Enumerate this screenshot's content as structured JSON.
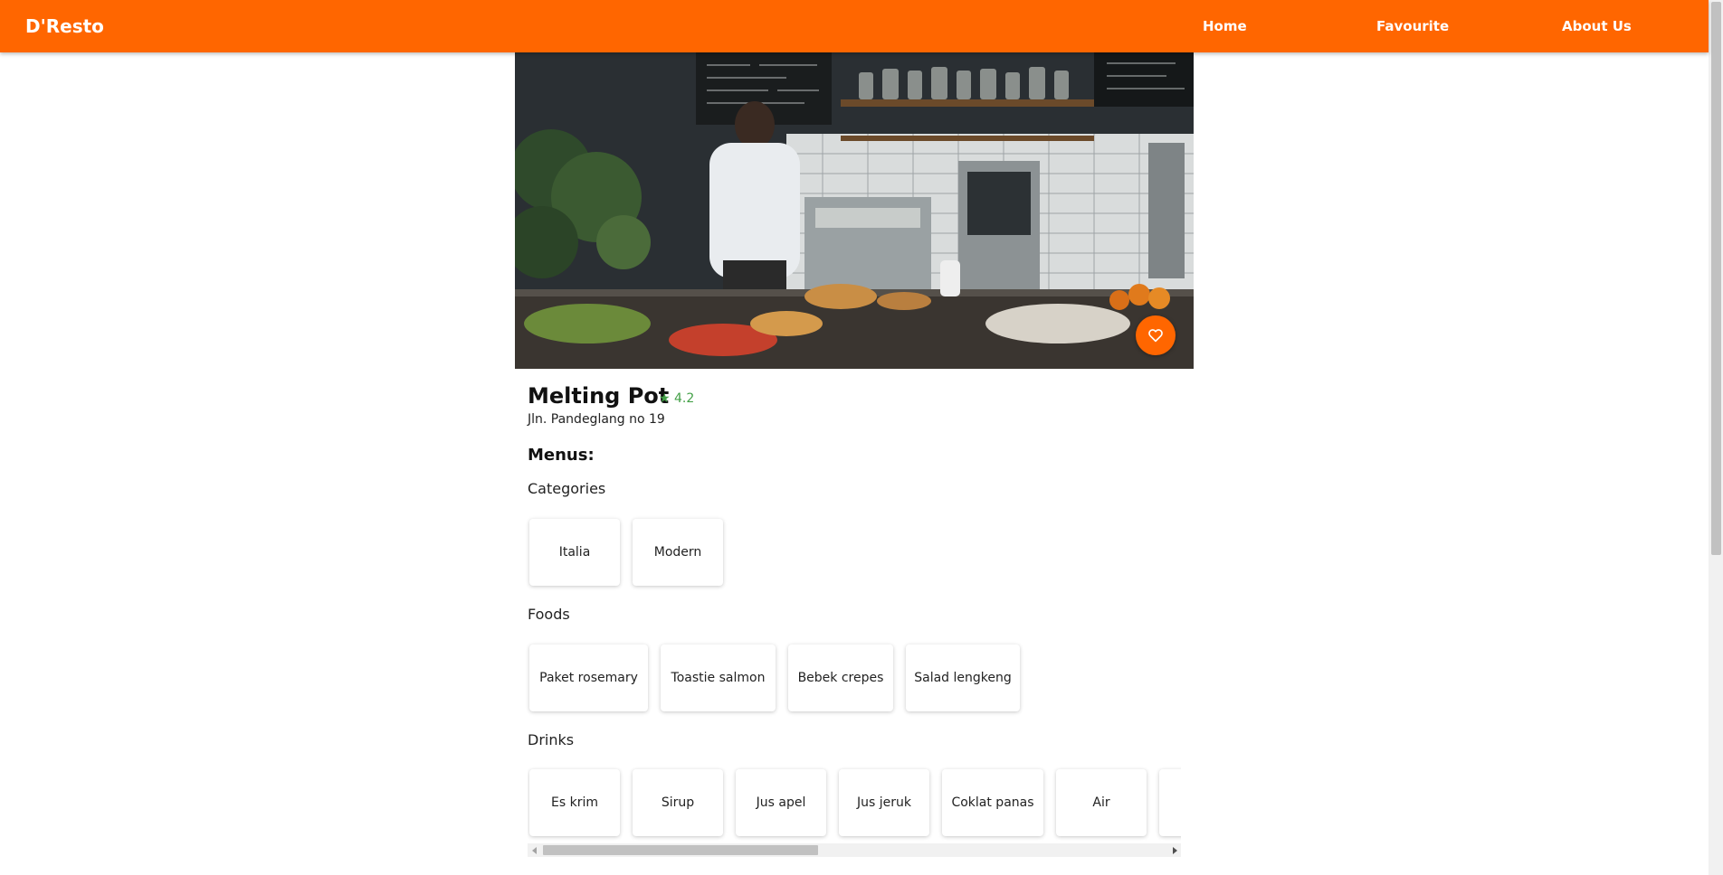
{
  "header": {
    "brand": "D'Resto",
    "nav": [
      "Home",
      "Favourite",
      "About Us"
    ],
    "color": "#ff6600"
  },
  "restaurant": {
    "name": "Melting Pot",
    "rating": "★ 4.2",
    "address": "Jln. Pandeglang no 19",
    "image_alt": "Melting Pot",
    "favourite_icon": "heart-outline-icon"
  },
  "menus": {
    "heading": "Menus:",
    "categories_label": "Categories",
    "categories": [
      "Italia",
      "Modern"
    ],
    "foods_label": "Foods",
    "foods": [
      "Paket rosemary",
      "Toastie salmon",
      "Bebek crepes",
      "Salad lengkeng"
    ],
    "drinks_label": "Drinks",
    "drinks": [
      "Es krim",
      "Sirup",
      "Jus apel",
      "Jus jeruk",
      "Coklat panas",
      "Air",
      ""
    ]
  },
  "colors": {
    "accent": "#ff6600",
    "rating": "#43a047"
  }
}
